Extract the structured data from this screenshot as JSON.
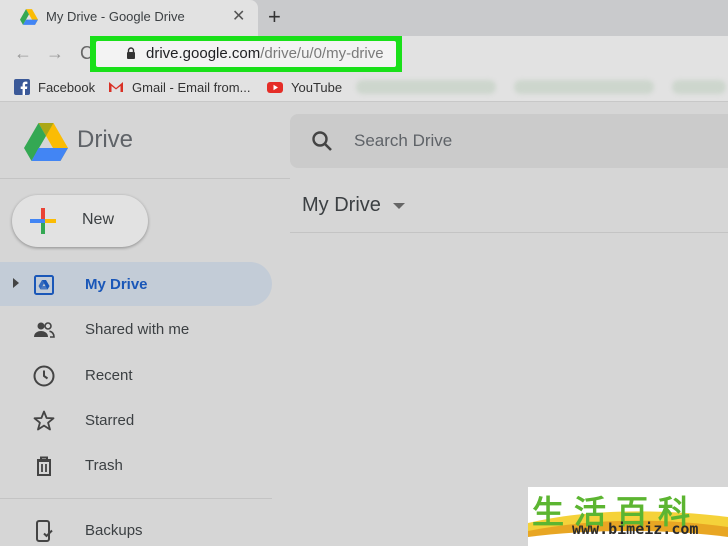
{
  "browser": {
    "tab": {
      "title": "My Drive - Google Drive",
      "close_glyph": "✕",
      "favicon": "google-drive-icon"
    },
    "new_tab_glyph": "+",
    "back_glyph": "←",
    "forward_glyph": "→",
    "reload_glyph": "C",
    "address": {
      "host": "drive.google.com",
      "path": "/drive/u/0/my-drive",
      "highlight_color": "#19e019"
    },
    "bookmarks": [
      {
        "label": "Facebook",
        "icon": "facebook-icon"
      },
      {
        "label": "Gmail - Email from...",
        "icon": "gmail-icon"
      },
      {
        "label": "YouTube",
        "icon": "youtube-icon"
      }
    ]
  },
  "sidebar": {
    "brand": "Drive",
    "new_button": "New",
    "items": [
      {
        "label": "My Drive",
        "icon": "my-drive-icon",
        "active": true
      },
      {
        "label": "Shared with me",
        "icon": "people-icon"
      },
      {
        "label": "Recent",
        "icon": "clock-icon"
      },
      {
        "label": "Starred",
        "icon": "star-icon"
      },
      {
        "label": "Trash",
        "icon": "trash-icon"
      },
      {
        "label": "Backups",
        "icon": "backup-phone-icon"
      }
    ]
  },
  "main": {
    "search_placeholder": "Search Drive",
    "page_title": "My Drive"
  },
  "watermark": {
    "chars": "生活百科",
    "url": "www.bimeiz.com"
  },
  "colors": {
    "accent_blue": "#1a57b8",
    "active_bg": "#c3ccd7",
    "highlight_green": "#19e019"
  }
}
